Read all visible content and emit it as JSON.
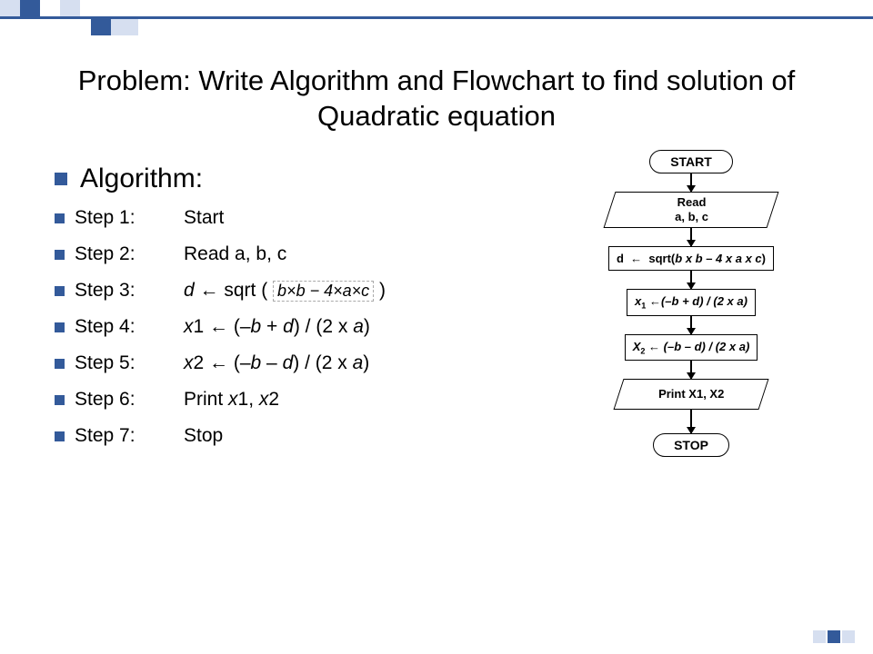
{
  "title": "Problem: Write Algorithm and Flowchart to find solution of Quadratic equation",
  "algo_heading": "Algorithm:",
  "steps": [
    {
      "label": "Step 1:",
      "text": "Start"
    },
    {
      "label": "Step 2:",
      "text": "Read a, b, c"
    },
    {
      "label": "Step 3:",
      "text": "d ← sqrt ( b×b − 4×a×c )"
    },
    {
      "label": "Step 4:",
      "text": "x1 ← (–b + d) / (2 x a)"
    },
    {
      "label": "Step 5:",
      "text": "x2 ← (–b – d) / (2 x a)"
    },
    {
      "label": "Step 6:",
      "text": "Print x1, x2"
    },
    {
      "label": "Step 7:",
      "text": "Stop"
    }
  ],
  "flowchart": {
    "start": "START",
    "read": "Read\na, b, c",
    "calc_d": "d  ←  sqrt(b x b – 4 x a x c)",
    "calc_x1": "x₁ ← (–b + d) / (2 x a)",
    "calc_x2": "X₂ ← (–b – d) / (2 x a)",
    "print": "Print X1, X2",
    "stop": "STOP"
  }
}
